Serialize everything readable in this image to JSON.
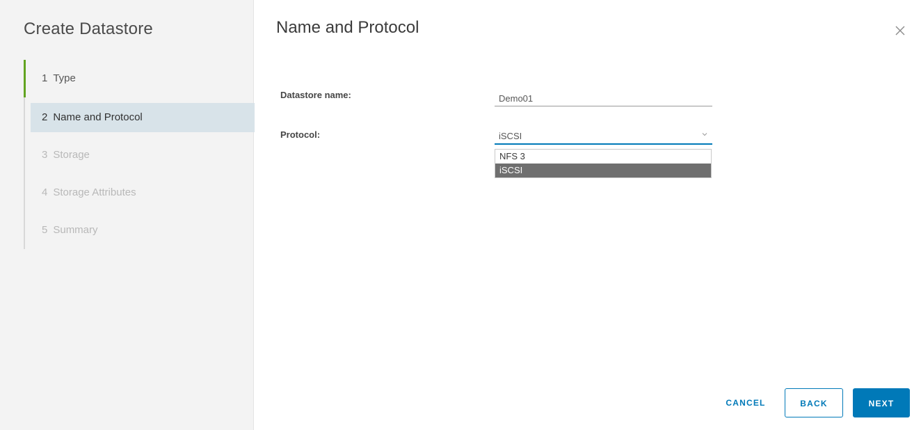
{
  "wizard": {
    "title": "Create Datastore",
    "steps": [
      {
        "number": "1",
        "label": "Type",
        "state": "done"
      },
      {
        "number": "2",
        "label": "Name and Protocol",
        "state": "current"
      },
      {
        "number": "3",
        "label": "Storage",
        "state": "disabled"
      },
      {
        "number": "4",
        "label": "Storage Attributes",
        "state": "disabled"
      },
      {
        "number": "5",
        "label": "Summary",
        "state": "disabled"
      }
    ]
  },
  "page": {
    "title": "Name and Protocol",
    "close_icon": "close-icon"
  },
  "form": {
    "datastore_name_label": "Datastore name:",
    "datastore_name_value": "Demo01",
    "protocol_label": "Protocol:",
    "protocol_value": "iSCSI",
    "protocol_options": [
      "NFS 3",
      "iSCSI"
    ],
    "protocol_selected_index": 1
  },
  "footer": {
    "cancel_label": "CANCEL",
    "back_label": "BACK",
    "next_label": "NEXT"
  },
  "colors": {
    "accent": "#0079b8",
    "step_complete": "#62a420",
    "current_step_bg": "#d8e3e9",
    "selected_option_bg": "#6f6f6f"
  }
}
